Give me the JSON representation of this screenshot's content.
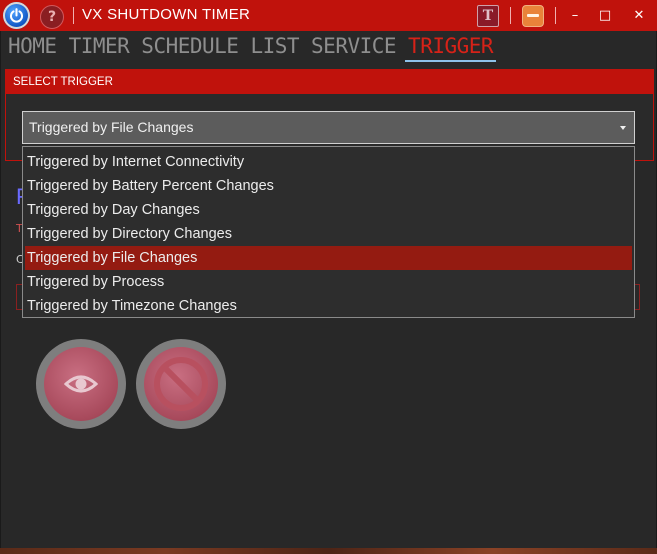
{
  "titlebar": {
    "title": "VX SHUTDOWN TIMER",
    "help_glyph": "?",
    "t_glyph": "T",
    "minimize_glyph": "–",
    "maximize_glyph": "□",
    "close_glyph": "✕",
    "icons": [
      "power-icon",
      "help-icon",
      "t-icon",
      "orange-minimize-icon",
      "minimize-icon",
      "maximize-icon",
      "close-icon"
    ]
  },
  "nav": {
    "tabs": [
      {
        "label": "HOME"
      },
      {
        "label": "TIMER"
      },
      {
        "label": "SCHEDULE"
      },
      {
        "label": "LIST"
      },
      {
        "label": "SERVICE"
      },
      {
        "label": "TRIGGER"
      }
    ],
    "active": "TRIGGER"
  },
  "select_trigger": {
    "header": "SELECT TRIGGER",
    "selected": "Triggered by File Changes",
    "options": [
      "Triggered by Internet Connectivity",
      "Triggered by Battery Percent Changes",
      "Triggered by Day Changes",
      "Triggered by Directory Changes",
      "Triggered by File Changes",
      "Triggered by Process",
      "Triggered by Timezone Changes"
    ]
  },
  "behind": {
    "a": "F",
    "b": "T",
    "c": "C"
  },
  "buttons": {
    "icons": [
      "eye-icon",
      "cancel-icon"
    ]
  },
  "colors": {
    "accent": "#c0120c",
    "active_tab": "#d62218",
    "selected_item": "#941b11",
    "tab_underline": "#8ec2ea"
  }
}
